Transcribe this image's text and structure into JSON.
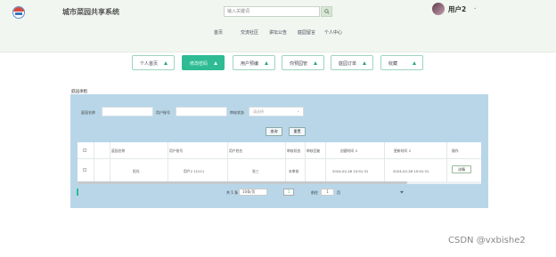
{
  "header": {
    "site_title": "城市菜园共享系统",
    "search_placeholder": "输入关键词",
    "user_name": "用户2",
    "user_caret": "⌄",
    "nav": [
      "首页",
      "交流社区",
      "讲坛公告",
      "庭园留言",
      "个人中心"
    ]
  },
  "tiles": [
    {
      "label": "个人首页"
    },
    {
      "label": "修改密码"
    },
    {
      "label": "用户预编"
    },
    {
      "label": "你预园管"
    },
    {
      "label": "庭园订单"
    },
    {
      "label": "收藏"
    }
  ],
  "section_label": "庭园承租",
  "filters": {
    "name_label": "庭园名称",
    "account_label": "用户账号",
    "status_label": "审核状态",
    "status_placeholder": "请选择"
  },
  "buttons": {
    "search": "查询",
    "reset": "重置"
  },
  "table": {
    "headers": [
      "庭园名称",
      "用户账号",
      "用户姓名",
      "审核状态",
      "审核回复",
      "创建时间 ⇕",
      "更新时间 ⇕",
      "操作"
    ],
    "rows": [
      {
        "name": "阳光",
        "account": "用户2 11211",
        "username": "张三",
        "status": "未审核",
        "reply": "",
        "created": "2024-02-28 15:51:31",
        "updated": "2024-02-28 15:51:31",
        "action": "详情"
      }
    ]
  },
  "pager": {
    "total": "共 1 条",
    "page_size": "10条/页",
    "prev": "‹",
    "current": "1",
    "next": "›",
    "goto_label": "前往",
    "goto_value": "1",
    "goto_unit": "页"
  },
  "watermark": "CSDN @vxbishe2",
  "colors": {
    "accent": "#2fbb94",
    "panel": "#b8d6e8",
    "header_bg": "#f1f6f0"
  }
}
